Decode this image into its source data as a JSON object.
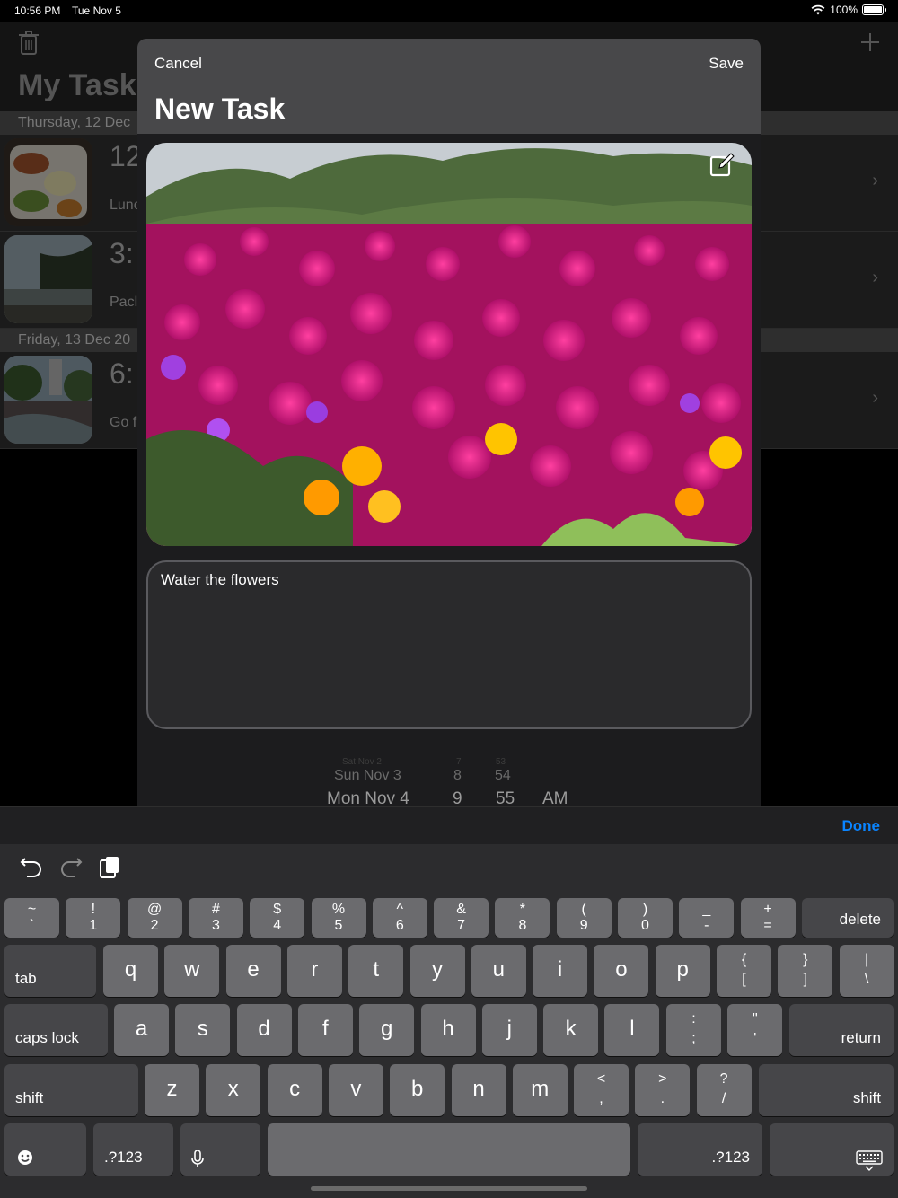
{
  "status_bar": {
    "time": "10:56 PM",
    "date": "Tue Nov 5",
    "battery": "100%"
  },
  "background": {
    "title": "My Tasks",
    "sections": [
      {
        "header": "Thursday, 12 Dec",
        "tasks": [
          {
            "time": "12",
            "desc": "Lunc"
          },
          {
            "time": "3:",
            "desc": "Pacl"
          }
        ]
      },
      {
        "header": "Friday, 13 Dec 20",
        "tasks": [
          {
            "time": "6:",
            "desc": "Go f"
          }
        ]
      }
    ]
  },
  "modal": {
    "cancel_label": "Cancel",
    "save_label": "Save",
    "title": "New Task",
    "note": "Water the flowers",
    "picker": {
      "rows": [
        {
          "day": "Sat Nov 2",
          "hour": "7",
          "minute": "53",
          "ampm": ""
        },
        {
          "day": "Sun Nov 3",
          "hour": "8",
          "minute": "54",
          "ampm": ""
        },
        {
          "day": "Mon Nov 4",
          "hour": "9",
          "minute": "55",
          "ampm": "AM"
        }
      ]
    }
  },
  "accessory": {
    "done_label": "Done"
  },
  "keyboard": {
    "number_row": [
      [
        "~",
        "`"
      ],
      [
        "!",
        "1"
      ],
      [
        "@",
        "2"
      ],
      [
        "#",
        "3"
      ],
      [
        "$",
        "4"
      ],
      [
        "%",
        "5"
      ],
      [
        "^",
        "6"
      ],
      [
        "&",
        "7"
      ],
      [
        "*",
        "8"
      ],
      [
        "(",
        "9"
      ],
      [
        ")",
        "0"
      ],
      [
        "_",
        "-"
      ],
      [
        "+",
        "="
      ]
    ],
    "delete": "delete",
    "tab": "tab",
    "row_q": [
      "q",
      "w",
      "e",
      "r",
      "t",
      "y",
      "u",
      "i",
      "o",
      "p"
    ],
    "row_q_extra": [
      [
        "{",
        "["
      ],
      [
        "}",
        "]"
      ],
      [
        "|",
        "\\"
      ]
    ],
    "caps": "caps lock",
    "row_a": [
      "a",
      "s",
      "d",
      "f",
      "g",
      "h",
      "j",
      "k",
      "l"
    ],
    "row_a_extra": [
      [
        ":",
        ";"
      ],
      [
        "\"",
        "'"
      ]
    ],
    "return": "return",
    "shift": "shift",
    "row_z": [
      "z",
      "x",
      "c",
      "v",
      "b",
      "n",
      "m"
    ],
    "row_z_extra": [
      [
        "<",
        ","
      ],
      [
        ">",
        "."
      ],
      [
        "?",
        "/"
      ]
    ],
    "num_switch": ".?123"
  },
  "colors": {
    "accent": "#0a84ff",
    "modal_header": "#48484a",
    "key": "#6b6b6e",
    "key_dark": "#464649"
  }
}
